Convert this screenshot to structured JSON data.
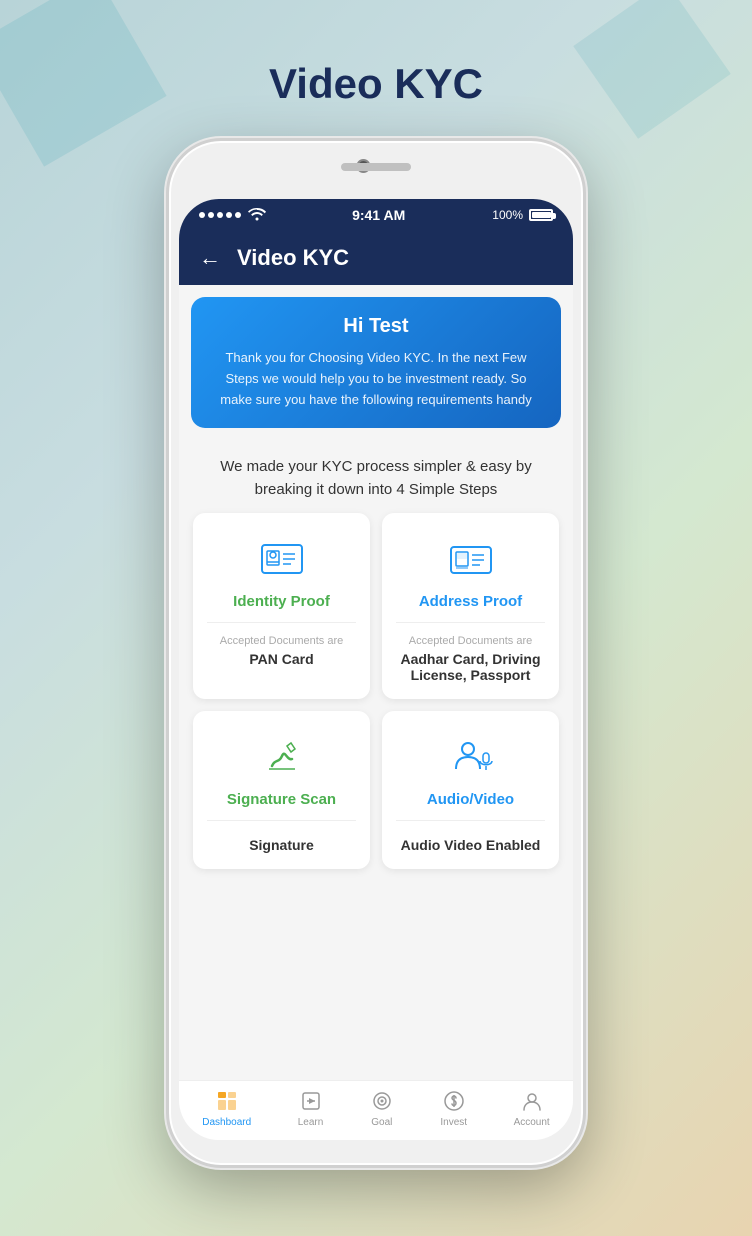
{
  "page": {
    "title": "Video KYC",
    "background_note": "gradient teal-green-peach"
  },
  "status_bar": {
    "signal": "•••••",
    "wifi": "wifi",
    "time": "9:41 AM",
    "battery_pct": "100%"
  },
  "nav": {
    "back_label": "←",
    "title": "Video KYC"
  },
  "banner": {
    "greeting": "Hi Test",
    "description": "Thank you for Choosing Video KYC. In the next Few Steps we would help you to be investment ready. So make sure you have the following requirements handy"
  },
  "subtitle": "We made your KYC process simpler & easy by breaking it down into 4 Simple Steps",
  "cards": [
    {
      "id": "identity-proof",
      "title": "Identity Proof",
      "title_color": "green",
      "doc_label": "Accepted Documents are",
      "doc_value": "PAN Card"
    },
    {
      "id": "address-proof",
      "title": "Address Proof",
      "title_color": "blue",
      "doc_label": "Accepted Documents are",
      "doc_value": "Aadhar Card, Driving License, Passport"
    },
    {
      "id": "signature-scan",
      "title": "Signature Scan",
      "title_color": "green",
      "doc_label": "",
      "doc_value": "Signature"
    },
    {
      "id": "audio-video",
      "title": "Audio/Video",
      "title_color": "blue",
      "doc_label": "",
      "doc_value": "Audio Video Enabled"
    }
  ],
  "tabs": [
    {
      "id": "dashboard",
      "label": "Dashboard",
      "active": true
    },
    {
      "id": "learn",
      "label": "Learn",
      "active": false
    },
    {
      "id": "goal",
      "label": "Goal",
      "active": false
    },
    {
      "id": "invest",
      "label": "Invest",
      "active": false
    },
    {
      "id": "account",
      "label": "Account",
      "active": false
    }
  ]
}
